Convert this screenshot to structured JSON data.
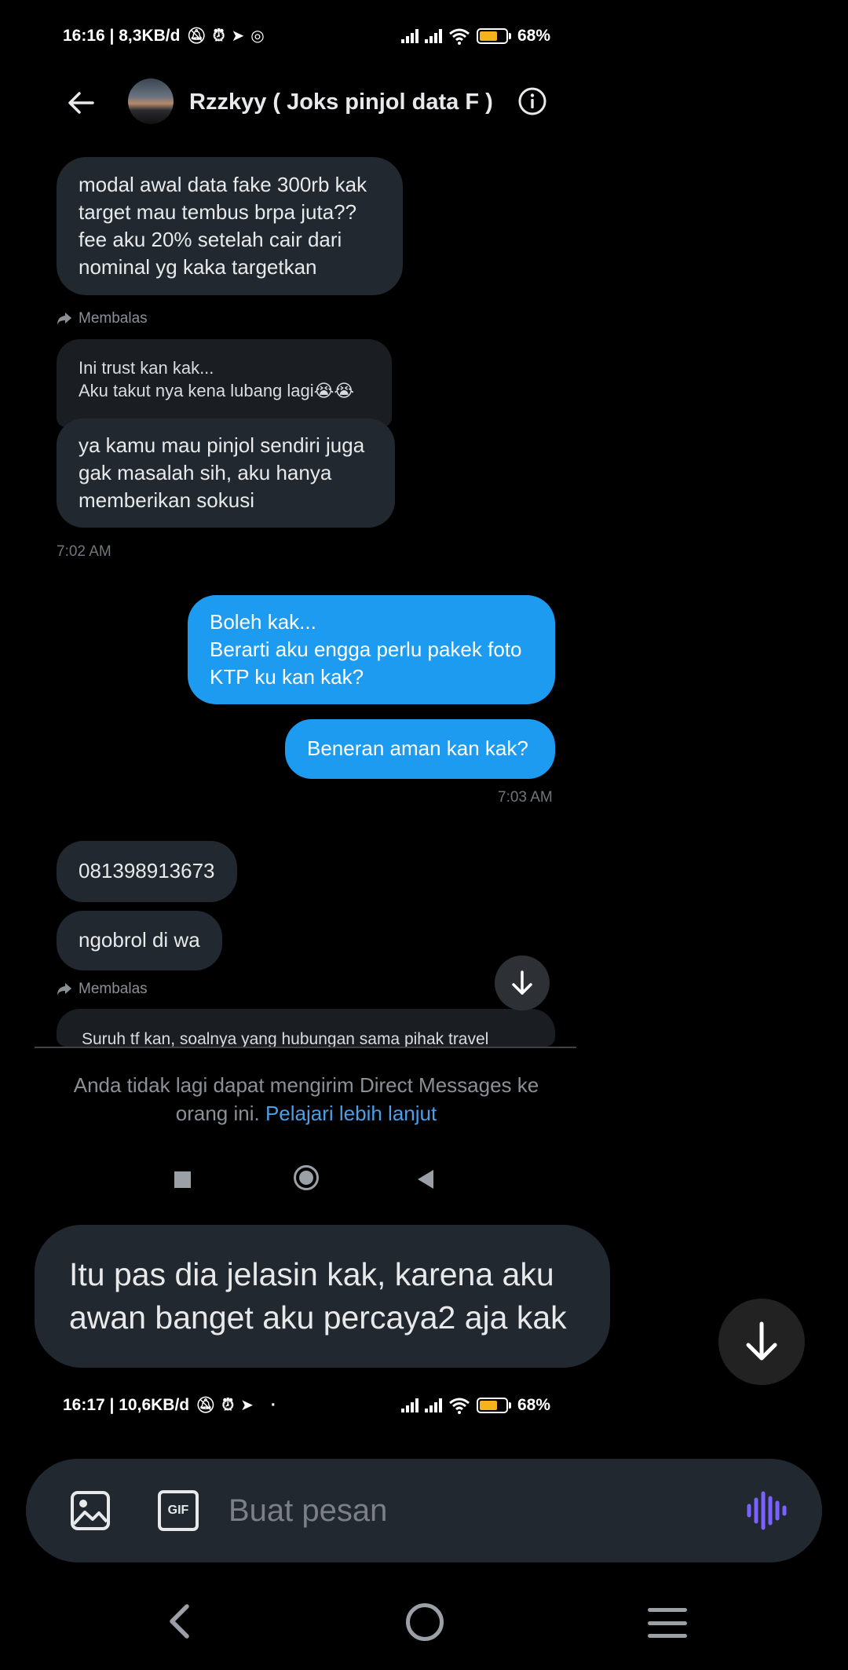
{
  "status_bar_top": {
    "time_info": "16:16 | 8,3KB/d",
    "battery": "68%"
  },
  "status_bar_bottom": {
    "time_info": "16:17 | 10,6KB/d",
    "dot": "·",
    "battery": "68%"
  },
  "battery_level": 0.68,
  "header": {
    "title": "Rzzkyy ( Joks pinjol data F )"
  },
  "messages": {
    "m1": "modal awal data fake 300rb kak target mau tembus brpa juta?? fee  aku 20% setelah cair dari nominal yg kaka targetkan",
    "replying_label_1": "Membalas",
    "quote_1_line1": "Ini trust kan kak...",
    "quote_1_line2": "Aku takut nya kena lubang lagi😭😭",
    "m2": "ya kamu mau pinjol sendiri juga gak masalah sih, aku hanya memberikan sokusi",
    "time_1": "7:02 AM",
    "m3_line1": "Boleh kak...",
    "m3_line2": "Berarti aku engga perlu pakek foto KTP ku kan kak?",
    "m4": "Beneran aman kan kak?",
    "time_2": "7:03 AM",
    "m5": "081398913673",
    "m6": "ngobrol di wa",
    "replying_label_2": "Membalas",
    "quote_2": "Suruh tf kan, soalnya yang hubungan sama pihak travel"
  },
  "blocked_notice": {
    "text": "Anda tidak lagi dapat mengirim Direct Messages ke orang ini.",
    "link": "Pelajari lebih lanjut"
  },
  "overlay_message": "Itu pas dia jelasin kak, karena aku awan banget aku percaya2 aja kak",
  "composer": {
    "placeholder": "Buat pesan",
    "gif_label": "GIF"
  },
  "colors": {
    "outgoing_bubble": "#1d9bf0",
    "incoming_bubble": "#22282f",
    "link": "#4a9fe8",
    "voice_accent": "#7b61ff",
    "battery": "#f6b31c"
  },
  "icons": [
    "back-arrow-icon",
    "info-icon",
    "reply-arrow-icon",
    "arrow-down-icon",
    "image-icon",
    "gif-icon",
    "voice-wave-icon",
    "mute-icon",
    "alarm-icon",
    "telegram-icon",
    "instagram-icon",
    "signal-icon",
    "wifi-icon",
    "battery-icon"
  ]
}
